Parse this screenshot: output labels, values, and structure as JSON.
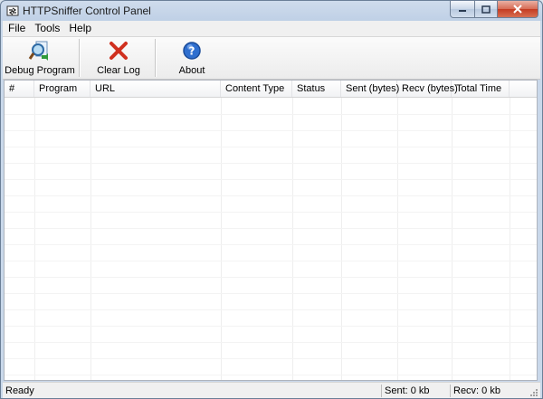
{
  "window": {
    "title": "HTTPSniffer Control Panel"
  },
  "menu": {
    "items": [
      "File",
      "Tools",
      "Help"
    ]
  },
  "toolbar": {
    "debug_label": "Debug Program",
    "clear_label": "Clear Log",
    "about_label": "About"
  },
  "table": {
    "columns": [
      "#",
      "Program",
      "URL",
      "Content Type",
      "Status",
      "Sent (bytes)",
      "Recv (bytes)",
      "Total Time"
    ],
    "rows": []
  },
  "status": {
    "text": "Ready",
    "sent": "Sent: 0 kb",
    "recv": "Recv: 0 kb"
  },
  "colors": {
    "close": "#c43b22",
    "title_bar": "#bfd0e6"
  },
  "icons": [
    "app-icon",
    "debug-program-icon",
    "clear-log-icon",
    "about-icon",
    "resize-grip-icon"
  ]
}
